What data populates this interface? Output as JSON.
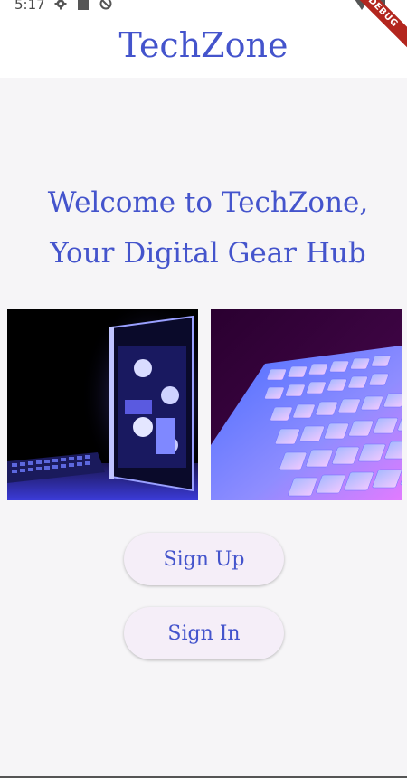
{
  "status_bar": {
    "time": "5:17",
    "icons": [
      "gear-icon",
      "sd-card-icon",
      "sync-blocked-icon",
      "signal-icon",
      "battery-icon"
    ]
  },
  "debug_banner": "DEBUG",
  "app_bar": {
    "title": "TechZone"
  },
  "welcome": {
    "line1": "Welcome to TechZone,",
    "line2": "Your Digital Gear Hub"
  },
  "images": [
    {
      "subject": "gaming-pc-with-rgb-keyboard"
    },
    {
      "subject": "backlit-keyboard"
    }
  ],
  "buttons": {
    "sign_up": "Sign Up",
    "sign_in": "Sign In"
  },
  "colors": {
    "accent": "#4454cc",
    "button_bg": "#f5eef8",
    "page_bg": "#f6f5f7",
    "debug": "#b3261e"
  }
}
